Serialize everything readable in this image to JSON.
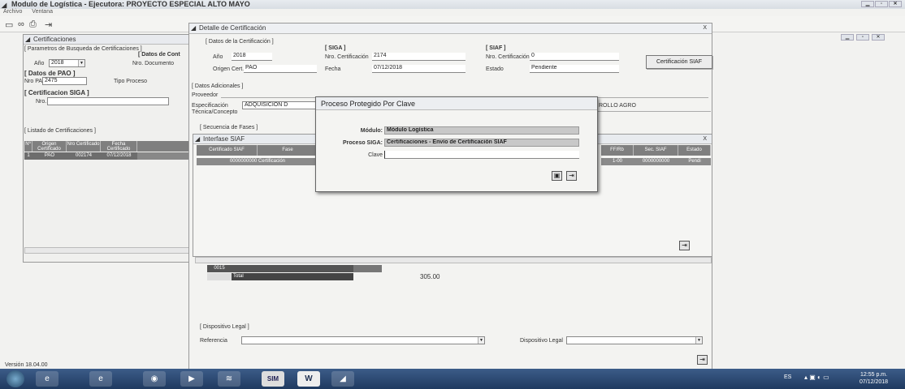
{
  "window": {
    "title": "Modulo de Logística - Ejecutora: PROYECTO ESPECIAL ALTO MAYO"
  },
  "menu": [
    "Archivo",
    "Ventana"
  ],
  "certificaciones": {
    "title": "Certificaciones",
    "params_section": "[ Parametros de Busqueda de Certificaciones ]",
    "datos_cont": "[ Datos de Cont",
    "anio_label": "Año",
    "anio_value": "2018",
    "nro_doc_label": "Nro. Documento",
    "datos_pao": "[ Datos de PAO ]",
    "nro_pao_label": "Nro PAO",
    "nro_pao_value": "2475",
    "tipo_proceso_label": "Tipo Proceso",
    "cert_siga": "[ Certificacion SIGA ]",
    "nro_label": "Nro.",
    "listado": "[ Listado de Certificaciones ]",
    "grid_headers": [
      "Nº",
      "Origen Certificado",
      "Nro Certificado",
      "Fecha Certificado"
    ],
    "grid_rows": [
      [
        "1",
        "PAO",
        "002174",
        "07/12/2018"
      ]
    ]
  },
  "version": "Versión 18.04.00",
  "detalle": {
    "title": "Detalle de Certificación",
    "close": "X",
    "datos_section": "[ Datos de la Certificación ]",
    "anio_label": "Año",
    "anio_value": "2018",
    "origen_label": "Origen Cert.",
    "origen_value": "PAO",
    "siga_section": "[ SIGA ]",
    "nro_cert_label": "Nro. Certificación",
    "nro_cert_value": "2174",
    "fecha_label": "Fecha",
    "fecha_value": "07/12/2018",
    "siaf_section": "[ SIAF ]",
    "siaf_nro_label": "Nro. Certificación",
    "siaf_nro_value": "0",
    "estado_label": "Estado",
    "estado_value": "Pendiente",
    "cert_siaf_button": "Certificación SIAF",
    "adicionales_section": "[ Datos Adicionales ]",
    "proveedor_label": "Proveedor",
    "especificacion_label": "Especificación Técnica/Concepto",
    "especificacion_value": "ADQUISICION D",
    "especificacion_tail": "ROLLO AGRO",
    "fases_section": "[ Secuencia de Fases ]",
    "fases_row_code": "0015",
    "fases_total_label": "Total",
    "fases_total_value": "305.00",
    "legal_section": "[ Dispositivo Legal ]",
    "referencia_label": "Referencia",
    "dispositivo_label": "Dispositivo Legal"
  },
  "interfase": {
    "title": "Interfase SIAF",
    "close": "X",
    "headers": [
      "Certificado SIAF",
      "Fase",
      "FF/Rb",
      "Sec. SIAF",
      "Estado"
    ],
    "row": [
      "0000000000 Certificación",
      "",
      "1-00",
      "0000000000",
      "Pendi"
    ]
  },
  "clave_dialog": {
    "title": "Proceso Protegido Por Clave",
    "modulo_label": "Módulo:",
    "modulo_value": "Módulo Logística",
    "proceso_label": "Proceso SIGA:",
    "proceso_value": "Certificaciones - Envío de Certificación SIAF",
    "clave_label": "Clave",
    "clave_value": ""
  },
  "taskbar": {
    "lang": "ES",
    "time": "12:55 p.m.",
    "date": "07/12/2018"
  }
}
